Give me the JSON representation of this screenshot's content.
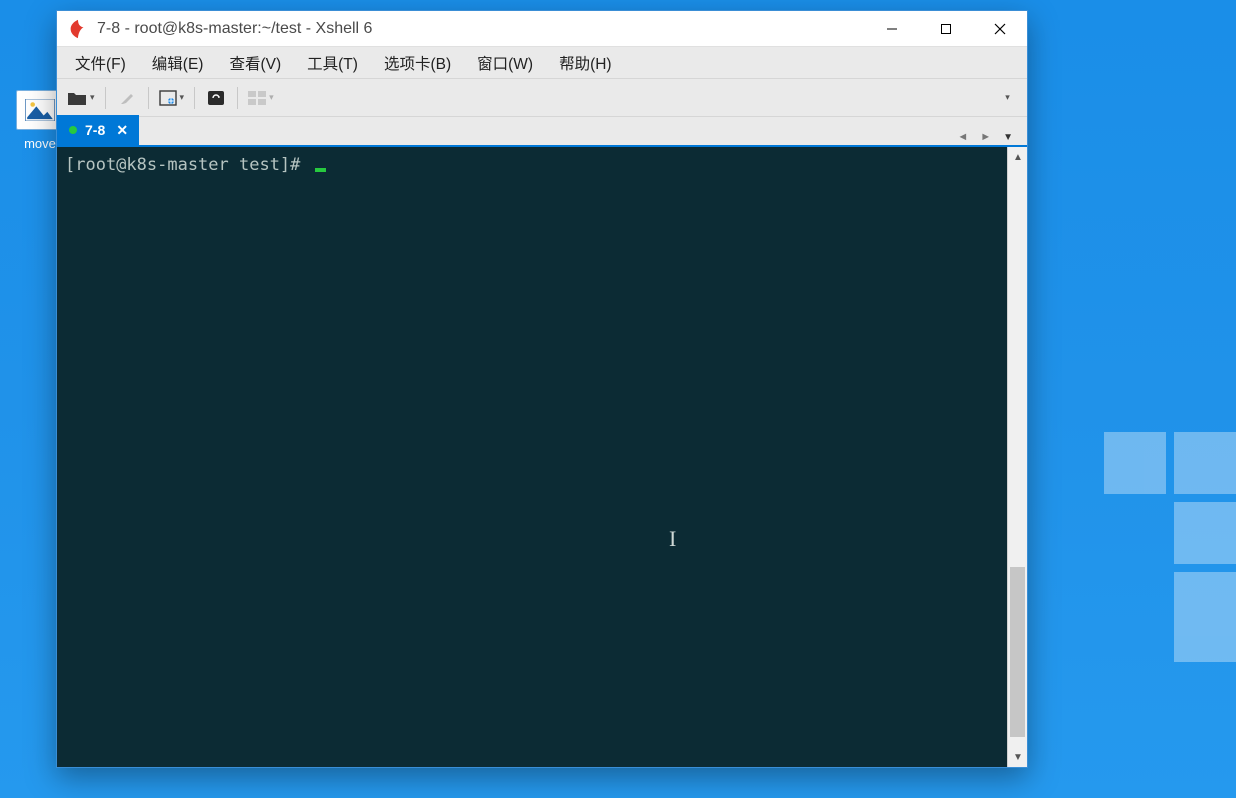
{
  "desktop": {
    "icon_label": "move"
  },
  "window": {
    "title": "7-8 - root@k8s-master:~/test - Xshell 6"
  },
  "menu": {
    "items": [
      "文件(F)",
      "编辑(E)",
      "查看(V)",
      "工具(T)",
      "选项卡(B)",
      "窗口(W)",
      "帮助(H)"
    ]
  },
  "tabs": [
    {
      "label": "7-8",
      "connected": true,
      "active": true
    }
  ],
  "terminal": {
    "prompt": "[root@k8s-master test]# "
  },
  "colors": {
    "accent": "#0078d7",
    "terminal_bg": "#0c2b34",
    "connected_dot": "#27c93f"
  }
}
